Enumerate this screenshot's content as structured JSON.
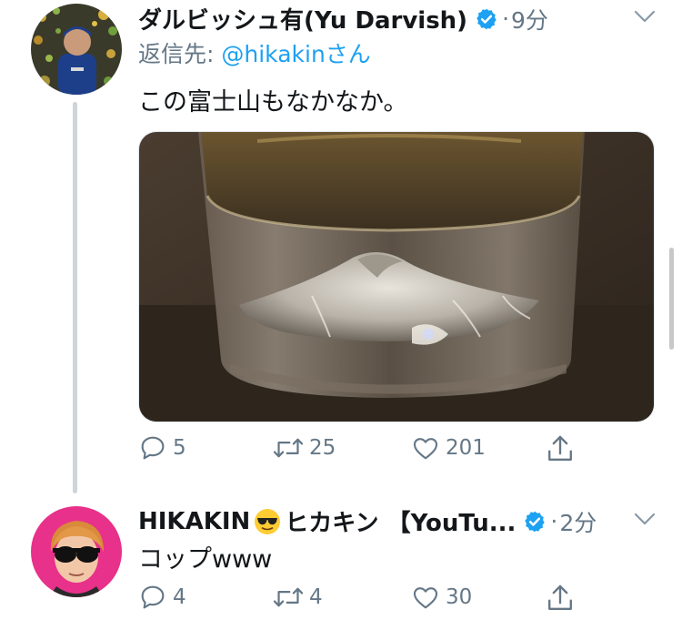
{
  "tweets": [
    {
      "author_name": "ダルビッシュ有(Yu Darvish)",
      "verified": true,
      "separator": "·",
      "time": "9分",
      "reply_label": "返信先:",
      "reply_handle": "@hikakinさん",
      "text": "この富士山もなかなか。",
      "has_media": true,
      "actions": {
        "replies": "5",
        "retweets": "25",
        "likes": "201"
      }
    },
    {
      "author_name_part1": "HIKAKIN",
      "author_name_part2": "ヒカキン 【YouTu...",
      "verified": true,
      "separator": "·",
      "time": "2分",
      "text": "コップwww",
      "actions": {
        "replies": "4",
        "retweets": "4",
        "likes": "30"
      }
    }
  ],
  "colors": {
    "verified_blue": "#1da1f2",
    "link_blue": "#1da1f2",
    "meta_gray": "#657786",
    "thread_line": "#cdd4da",
    "hikakin_avatar_bg": "#e8318a"
  },
  "icons": [
    "verified-badge-icon",
    "chevron-down-icon",
    "reply-icon",
    "retweet-icon",
    "like-icon",
    "share-icon",
    "sunglasses-emoji-icon"
  ]
}
